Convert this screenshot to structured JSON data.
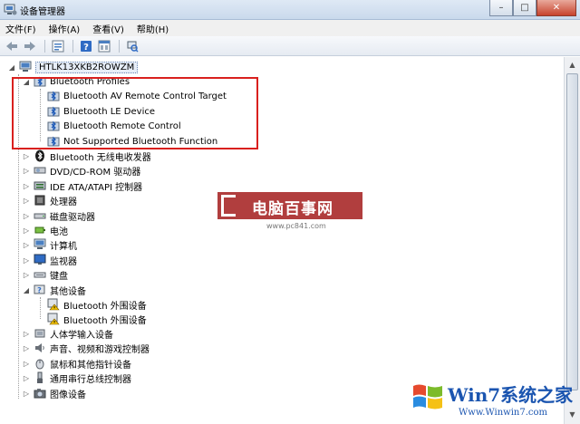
{
  "window": {
    "title": "设备管理器",
    "controls": {
      "minimize": "–",
      "maximize": "□",
      "close": "✕"
    }
  },
  "menu": [
    {
      "label": "文件(F)"
    },
    {
      "label": "操作(A)"
    },
    {
      "label": "查看(V)"
    },
    {
      "label": "帮助(H)"
    }
  ],
  "toolbar": {
    "icons": [
      "back-arrow-icon",
      "forward-arrow-icon",
      "properties-icon",
      "help-icon",
      "view-icon",
      "scan-hardware-icon"
    ]
  },
  "tree": {
    "root": "HTLK13XKB2ROWZM",
    "bluetooth_profiles": {
      "label": "Bluetooth Profiles",
      "children": [
        "Bluetooth AV Remote Control Target",
        "Bluetooth LE Device",
        "Bluetooth Remote Control",
        "Not Supported Bluetooth Function"
      ]
    },
    "categories": [
      "Bluetooth 无线电收发器",
      "DVD/CD-ROM 驱动器",
      "IDE ATA/ATAPI 控制器",
      "处理器",
      "磁盘驱动器",
      "电池",
      "计算机",
      "监视器",
      "键盘"
    ],
    "other_devices": {
      "label": "其他设备",
      "children": [
        "Bluetooth 外围设备",
        "Bluetooth 外围设备"
      ]
    },
    "more_categories": [
      "人体学输入设备",
      "声音、视频和游戏控制器",
      "鼠标和其他指针设备",
      "通用串行总线控制器",
      "图像设备"
    ]
  },
  "watermarks": {
    "site1_name": "电脑百事网",
    "site1_url": "www.pc841.com",
    "site2_name": "Win7系统之家",
    "site2_url": "Www.Winwin7.com"
  },
  "colors": {
    "highlight_box": "#d9201e",
    "titlebar": "#c9d9ec"
  }
}
